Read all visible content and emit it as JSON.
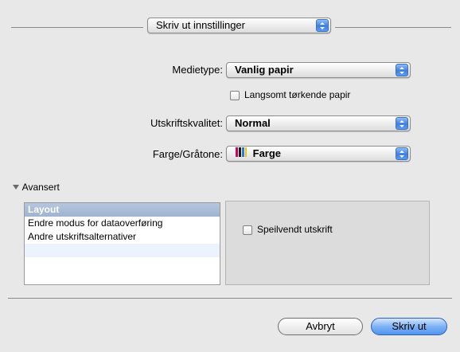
{
  "header": {
    "section_popup": {
      "value": "Skriv ut innstillinger"
    }
  },
  "form": {
    "media_type": {
      "label": "Medietype:",
      "value": "Vanlig papir"
    },
    "slow_dry": {
      "label": "Langsomt tørkende papir",
      "checked": false
    },
    "quality": {
      "label": "Utskriftskvalitet:",
      "value": "Normal"
    },
    "color": {
      "label": "Farge/Gråtone:",
      "value": "Farge",
      "swatch_colors": [
        "#d4005a",
        "#1a1a1a",
        "#2e7bd6",
        "#e8c800"
      ]
    }
  },
  "advanced": {
    "disclosure_label": "Avansert",
    "expanded": true,
    "list_items": [
      {
        "label": "Layout",
        "selected": true
      },
      {
        "label": "Endre modus for dataoverføring",
        "selected": false
      },
      {
        "label": "Andre utskriftsalternativer",
        "selected": false
      }
    ],
    "mirror_print": {
      "label": "Speilvendt utskrift",
      "checked": false
    }
  },
  "footer": {
    "cancel_label": "Avbryt",
    "print_label": "Skriv ut"
  },
  "colors": {
    "background": "#e8e8e8",
    "accent": "#4f95f0",
    "selection": "#9fb3d0"
  }
}
